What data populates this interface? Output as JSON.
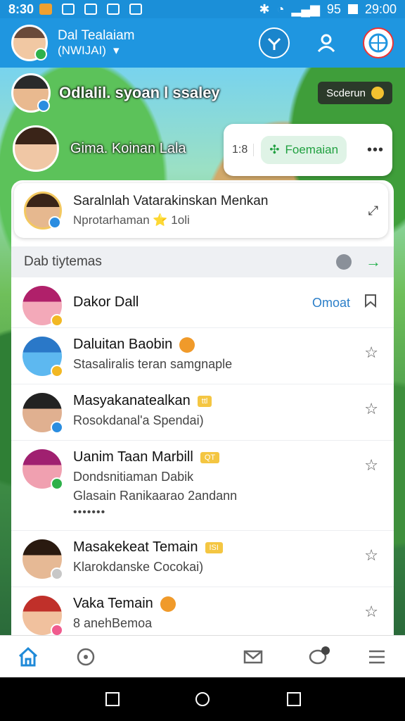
{
  "status_bar": {
    "time": "8:30",
    "battery": "95",
    "clock": "29:00"
  },
  "header": {
    "title": "Dal Tealaiam",
    "subtitle": "(NWIJAI)",
    "actions": [
      "map-pin-button",
      "profile-button",
      "globe-button"
    ]
  },
  "scene": {
    "row1_text": "Odlalil. syoan l ssaley",
    "pill_label": "Scderun",
    "row2_text": "Gima. Koinan Lala",
    "card_number": "1:8",
    "card_button": "Foemaian",
    "card_more": "•••"
  },
  "top_card": {
    "title": "Saralnlah Vatarakinskan Menkan",
    "subtitle": "Nprotarhaman ⭐ 1oli"
  },
  "section": {
    "title": "Dab tiytemas"
  },
  "items": [
    {
      "name": "Dakor Dall",
      "sub": "",
      "link": "Omoat",
      "tag": ""
    },
    {
      "name": "Daluitan Baobin",
      "sub": "Stasaliralis teran samgnaple",
      "tag": ""
    },
    {
      "name": "Masyakanatealkan",
      "sub": "Rosokdanal'a Spendai)",
      "tag": "ttl"
    },
    {
      "name": "Uanim Taan Marbill",
      "sub": "Dondsnitiaman Dabik",
      "sub2": "Glasain Ranikaarao 2andann",
      "dots": "•••••••",
      "tag": "QT"
    },
    {
      "name": "Masakekeat Temain",
      "sub": "Klarokdanske Cocokai)",
      "tag": "ISI"
    },
    {
      "name": "Vaka Temain",
      "sub": "8 anehBemoa",
      "tag": ""
    }
  ],
  "colors": {
    "accent": "#1f96e0",
    "green": "#22b04a",
    "link": "#2a7ec8",
    "tag": "#f4c642"
  }
}
